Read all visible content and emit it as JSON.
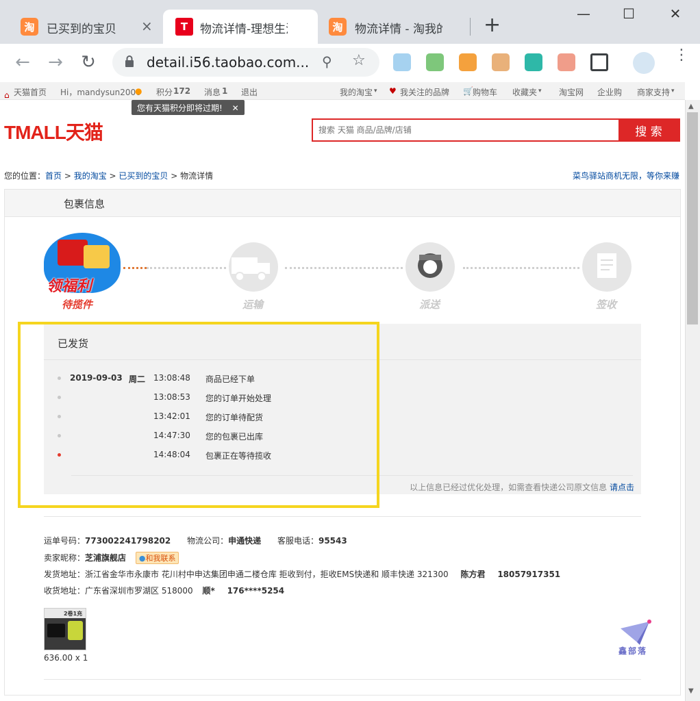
{
  "browser": {
    "tabs": [
      {
        "title": "已买到的宝贝",
        "favicon": "淘"
      },
      {
        "title": "物流详情-理想生活上天猫",
        "favicon": "T"
      },
      {
        "title": "物流详情 - 淘我的",
        "favicon": "淘"
      }
    ],
    "url": "detail.i56.taobao.com...",
    "new_tab": "+",
    "close": "×"
  },
  "sitenav": {
    "home": "天猫首页",
    "greeting": "Hi，mandysun2006",
    "points_label": "积分",
    "points": "172",
    "messages_label": "消息",
    "messages": "1",
    "logout": "退出",
    "my_taobao": "我的淘宝",
    "brands": "我关注的品牌",
    "cart": "购物车",
    "favorites": "收藏夹",
    "taobao": "淘宝网",
    "enterprise": "企业购",
    "merchant": "商家支持",
    "tip": "您有天猫积分即将过期!"
  },
  "header": {
    "logo": "TMALL天猫",
    "search_placeholder": "搜索 天猫 商品/品牌/店铺",
    "search_button": "搜 索"
  },
  "breadcrumb": {
    "prefix": "您的位置：",
    "items": [
      "首页",
      "我的淘宝",
      "已买到的宝贝",
      "物流详情"
    ],
    "promo": "菜鸟驿站商机无限，等你来赚"
  },
  "package": {
    "title": "包裹信息",
    "steps": [
      "待揽件",
      "运输",
      "派送",
      "签收"
    ],
    "banner": "领福利",
    "status": "已发货",
    "events": [
      {
        "date": "2019-09-03",
        "week": "周二",
        "time": "13:08:48",
        "msg": "商品已经下单"
      },
      {
        "date": "",
        "week": "",
        "time": "13:08:53",
        "msg": "您的订单开始处理"
      },
      {
        "date": "",
        "week": "",
        "time": "13:42:01",
        "msg": "您的订单待配货"
      },
      {
        "date": "",
        "week": "",
        "time": "14:47:30",
        "msg": "您的包裹已出库"
      },
      {
        "date": "",
        "week": "",
        "time": "14:48:04",
        "msg": "包裹正在等待揽收"
      }
    ],
    "note": "以上信息已经过优化处理，如需查看快递公司原文信息",
    "note_link": "请点击"
  },
  "shipment": {
    "waybill_label": "运单号码：",
    "waybill": "773002241798202",
    "company_label": "物流公司：",
    "company": "申通快递",
    "phone_label": "客服电话：",
    "phone": "95543",
    "seller_label": "卖家昵称：",
    "seller": "芝浦旗舰店",
    "contact": "和我联系",
    "from_label": "发货地址：",
    "from_addr": "浙江省金华市永康市 花川村中申达集团申通二楼仓库 拒收到付，拒收EMS快递和 顺丰快递 321300",
    "from_name": "陈方君",
    "from_phone": "18057917351",
    "to_label": "收货地址：",
    "to_addr": "广东省深圳市罗湖区 518000",
    "to_name": "顺*",
    "to_phone": "176****5254",
    "price": "636.00 x 1",
    "product_badge": "2卷1充"
  },
  "watermark": "鑫部落",
  "colors": {
    "tmall_red": "#dd2727",
    "highlight": "#f5d51f",
    "link": "#00489e"
  }
}
